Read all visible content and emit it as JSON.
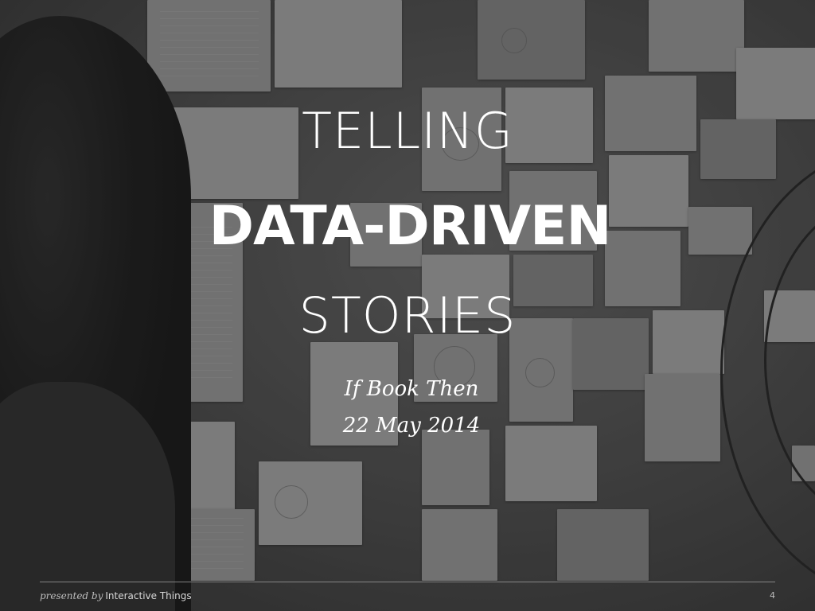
{
  "slide": {
    "title_line1": "TELLING",
    "title_line2": "DATA-DRIVEN",
    "title_line3": "STORIES",
    "event": "If Book Then",
    "date": "22 May 2014"
  },
  "footer": {
    "presented_by": "presented by",
    "organization": "Interactive Things",
    "page_number": "4"
  },
  "colors": {
    "text": "#ffffff",
    "footer_rule": "#9a9a9a"
  }
}
